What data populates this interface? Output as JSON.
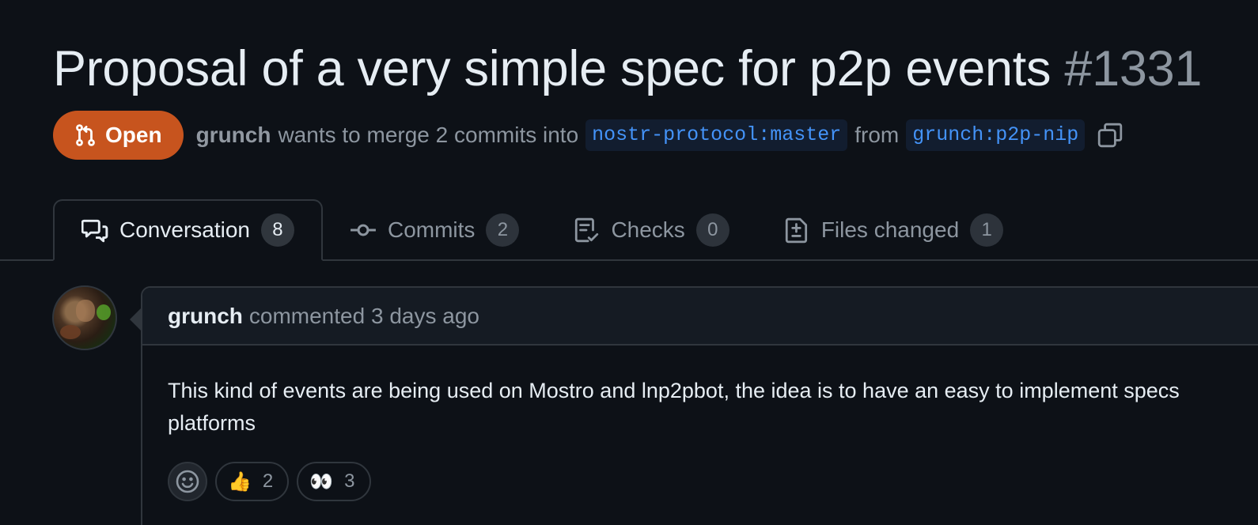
{
  "pr": {
    "title": "Proposal of a very simple spec for p2p events",
    "number": "#1331",
    "state": "Open",
    "state_color": "#c7541e",
    "author": "grunch",
    "merge_text": "wants to merge 2 commits into",
    "base_branch": "nostr-protocol:master",
    "from_text": "from",
    "head_branch": "grunch:p2p-nip",
    "copy_icon": "copy-icon"
  },
  "tabs": [
    {
      "label": "Conversation",
      "count": "8",
      "icon": "comment-discussion-icon",
      "active": true
    },
    {
      "label": "Commits",
      "count": "2",
      "icon": "git-commit-icon",
      "active": false
    },
    {
      "label": "Checks",
      "count": "0",
      "icon": "checklist-icon",
      "active": false
    },
    {
      "label": "Files changed",
      "count": "1",
      "icon": "file-diff-icon",
      "active": false
    }
  ],
  "comment": {
    "author": "grunch",
    "action": "commented",
    "time": "3 days ago",
    "body_line1": "This kind of events are being used on Mostro and lnp2pbot, the idea is to have an easy to implement specs",
    "body_line2": "platforms",
    "reactions": [
      {
        "emoji": "👍",
        "count": "2"
      },
      {
        "emoji": "👀",
        "count": "3"
      }
    ]
  },
  "colors": {
    "background": "#0d1117",
    "link": "#4493f8",
    "muted": "#8d96a0",
    "border": "#30363d"
  }
}
